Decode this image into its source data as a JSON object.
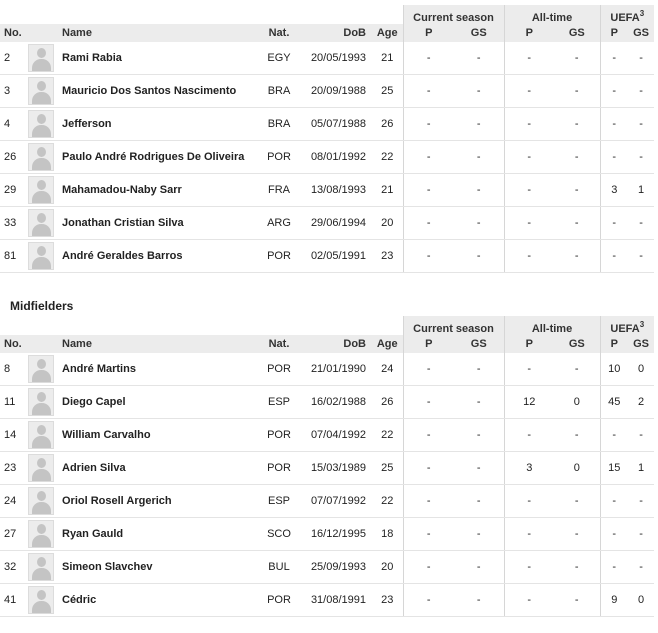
{
  "headers": {
    "no": "No.",
    "name": "Name",
    "nat": "Nat.",
    "dob": "DoB",
    "age": "Age",
    "current_season": "Current season",
    "all_time": "All-time",
    "uefa": "UEFA",
    "uefa_sup": "3",
    "p": "P",
    "gs": "GS"
  },
  "sections": [
    {
      "title": "",
      "rows": [
        {
          "no": "2",
          "name": "Rami Rabia",
          "nat": "EGY",
          "dob": "20/05/1993",
          "age": "21",
          "cs_p": "-",
          "cs_gs": "-",
          "at_p": "-",
          "at_gs": "-",
          "u_p": "-",
          "u_gs": "-"
        },
        {
          "no": "3",
          "name": "Mauricio Dos Santos Nascimento",
          "nat": "BRA",
          "dob": "20/09/1988",
          "age": "25",
          "cs_p": "-",
          "cs_gs": "-",
          "at_p": "-",
          "at_gs": "-",
          "u_p": "-",
          "u_gs": "-"
        },
        {
          "no": "4",
          "name": "Jefferson",
          "nat": "BRA",
          "dob": "05/07/1988",
          "age": "26",
          "cs_p": "-",
          "cs_gs": "-",
          "at_p": "-",
          "at_gs": "-",
          "u_p": "-",
          "u_gs": "-"
        },
        {
          "no": "26",
          "name": "Paulo André Rodrigues De Oliveira",
          "nat": "POR",
          "dob": "08/01/1992",
          "age": "22",
          "cs_p": "-",
          "cs_gs": "-",
          "at_p": "-",
          "at_gs": "-",
          "u_p": "-",
          "u_gs": "-"
        },
        {
          "no": "29",
          "name": "Mahamadou-Naby Sarr",
          "nat": "FRA",
          "dob": "13/08/1993",
          "age": "21",
          "cs_p": "-",
          "cs_gs": "-",
          "at_p": "-",
          "at_gs": "-",
          "u_p": "3",
          "u_gs": "1"
        },
        {
          "no": "33",
          "name": "Jonathan Cristian Silva",
          "nat": "ARG",
          "dob": "29/06/1994",
          "age": "20",
          "cs_p": "-",
          "cs_gs": "-",
          "at_p": "-",
          "at_gs": "-",
          "u_p": "-",
          "u_gs": "-"
        },
        {
          "no": "81",
          "name": "André Geraldes Barros",
          "nat": "POR",
          "dob": "02/05/1991",
          "age": "23",
          "cs_p": "-",
          "cs_gs": "-",
          "at_p": "-",
          "at_gs": "-",
          "u_p": "-",
          "u_gs": "-"
        }
      ]
    },
    {
      "title": "Midfielders",
      "rows": [
        {
          "no": "8",
          "name": "André Martins",
          "nat": "POR",
          "dob": "21/01/1990",
          "age": "24",
          "cs_p": "-",
          "cs_gs": "-",
          "at_p": "-",
          "at_gs": "-",
          "u_p": "10",
          "u_gs": "0"
        },
        {
          "no": "11",
          "name": "Diego Capel",
          "nat": "ESP",
          "dob": "16/02/1988",
          "age": "26",
          "cs_p": "-",
          "cs_gs": "-",
          "at_p": "12",
          "at_gs": "0",
          "u_p": "45",
          "u_gs": "2"
        },
        {
          "no": "14",
          "name": "William Carvalho",
          "nat": "POR",
          "dob": "07/04/1992",
          "age": "22",
          "cs_p": "-",
          "cs_gs": "-",
          "at_p": "-",
          "at_gs": "-",
          "u_p": "-",
          "u_gs": "-"
        },
        {
          "no": "23",
          "name": "Adrien Silva",
          "nat": "POR",
          "dob": "15/03/1989",
          "age": "25",
          "cs_p": "-",
          "cs_gs": "-",
          "at_p": "3",
          "at_gs": "0",
          "u_p": "15",
          "u_gs": "1"
        },
        {
          "no": "24",
          "name": "Oriol Rosell Argerich",
          "nat": "ESP",
          "dob": "07/07/1992",
          "age": "22",
          "cs_p": "-",
          "cs_gs": "-",
          "at_p": "-",
          "at_gs": "-",
          "u_p": "-",
          "u_gs": "-"
        },
        {
          "no": "27",
          "name": "Ryan Gauld",
          "nat": "SCO",
          "dob": "16/12/1995",
          "age": "18",
          "cs_p": "-",
          "cs_gs": "-",
          "at_p": "-",
          "at_gs": "-",
          "u_p": "-",
          "u_gs": "-"
        },
        {
          "no": "32",
          "name": "Simeon Slavchev",
          "nat": "BUL",
          "dob": "25/09/1993",
          "age": "20",
          "cs_p": "-",
          "cs_gs": "-",
          "at_p": "-",
          "at_gs": "-",
          "u_p": "-",
          "u_gs": "-"
        },
        {
          "no": "41",
          "name": "Cédric",
          "nat": "POR",
          "dob": "31/08/1991",
          "age": "23",
          "cs_p": "-",
          "cs_gs": "-",
          "at_p": "-",
          "at_gs": "-",
          "u_p": "9",
          "u_gs": "0"
        }
      ]
    }
  ]
}
